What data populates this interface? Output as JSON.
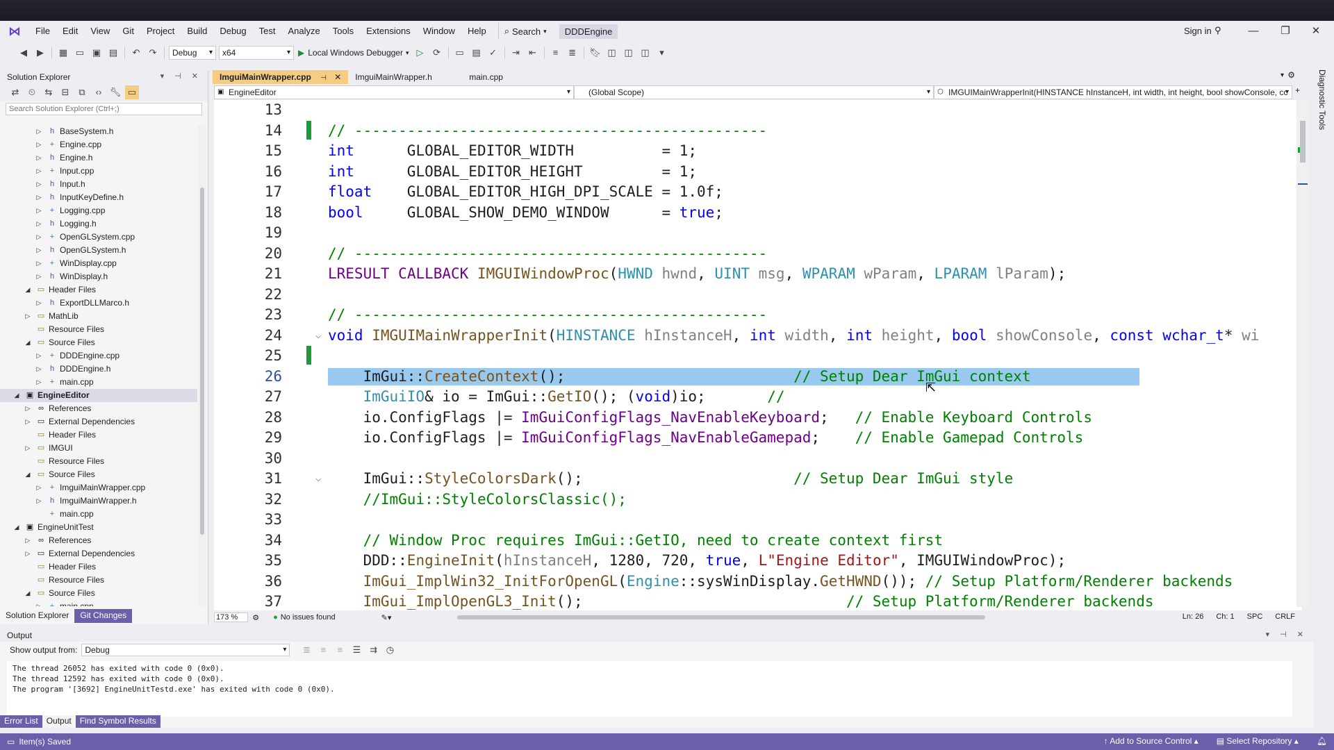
{
  "app": {
    "menu": [
      "File",
      "Edit",
      "View",
      "Git",
      "Project",
      "Build",
      "Debug",
      "Test",
      "Analyze",
      "Tools",
      "Extensions",
      "Window",
      "Help"
    ],
    "search_label": "Search",
    "solution_name": "DDDEngine",
    "sign_in": "Sign in"
  },
  "toolbar": {
    "config": "Debug",
    "platform": "x64",
    "debugger": "Local Windows Debugger"
  },
  "solution_explorer": {
    "title": "Solution Explorer",
    "search_placeholder": "Search Solution Explorer (Ctrl+;)",
    "items": [
      {
        "label": "BaseSystem.h",
        "level": 3,
        "arrow": "▷",
        "icon": "header-file"
      },
      {
        "label": "Engine.cpp",
        "level": 3,
        "arrow": "▷",
        "icon": "cpp-file"
      },
      {
        "label": "Engine.h",
        "level": 3,
        "arrow": "▷",
        "icon": "header-file"
      },
      {
        "label": "Input.cpp",
        "level": 3,
        "arrow": "▷",
        "icon": "cpp-file"
      },
      {
        "label": "Input.h",
        "level": 3,
        "arrow": "▷",
        "icon": "header-file"
      },
      {
        "label": "InputKeyDefine.h",
        "level": 3,
        "arrow": "▷",
        "icon": "header-file"
      },
      {
        "label": "Logging.cpp",
        "level": 3,
        "arrow": "▷",
        "icon": "cpp-file"
      },
      {
        "label": "Logging.h",
        "level": 3,
        "arrow": "▷",
        "icon": "header-file"
      },
      {
        "label": "OpenGLSystem.cpp",
        "level": 3,
        "arrow": "▷",
        "icon": "cpp-file"
      },
      {
        "label": "OpenGLSystem.h",
        "level": 3,
        "arrow": "▷",
        "icon": "header-file"
      },
      {
        "label": "WinDisplay.cpp",
        "level": 3,
        "arrow": "▷",
        "icon": "cpp-file"
      },
      {
        "label": "WinDisplay.h",
        "level": 3,
        "arrow": "▷",
        "icon": "header-file"
      },
      {
        "label": "Header Files",
        "level": 2,
        "arrow": "◢",
        "icon": "folder"
      },
      {
        "label": "ExportDLLMarco.h",
        "level": 3,
        "arrow": "▷",
        "icon": "header-file"
      },
      {
        "label": "MathLib",
        "level": 2,
        "arrow": "▷",
        "icon": "folder"
      },
      {
        "label": "Resource Files",
        "level": 2,
        "arrow": "",
        "icon": "folder"
      },
      {
        "label": "Source Files",
        "level": 2,
        "arrow": "◢",
        "icon": "folder"
      },
      {
        "label": "DDDEngine.cpp",
        "level": 3,
        "arrow": "▷",
        "icon": "cpp-file"
      },
      {
        "label": "DDDEngine.h",
        "level": 3,
        "arrow": "▷",
        "icon": "header-file"
      },
      {
        "label": "main.cpp",
        "level": 3,
        "arrow": "▷",
        "icon": "cpp-file"
      },
      {
        "label": "EngineEditor",
        "level": 1,
        "arrow": "◢",
        "icon": "project",
        "selected": true
      },
      {
        "label": "References",
        "level": 2,
        "arrow": "▷",
        "icon": "references"
      },
      {
        "label": "External Dependencies",
        "level": 2,
        "arrow": "▷",
        "icon": "external"
      },
      {
        "label": "Header Files",
        "level": 2,
        "arrow": "",
        "icon": "folder"
      },
      {
        "label": "IMGUI",
        "level": 2,
        "arrow": "▷",
        "icon": "folder"
      },
      {
        "label": "Resource Files",
        "level": 2,
        "arrow": "",
        "icon": "folder"
      },
      {
        "label": "Source Files",
        "level": 2,
        "arrow": "◢",
        "icon": "folder"
      },
      {
        "label": "ImguiMainWrapper.cpp",
        "level": 3,
        "arrow": "▷",
        "icon": "cpp-file"
      },
      {
        "label": "ImguiMainWrapper.h",
        "level": 3,
        "arrow": "▷",
        "icon": "header-file"
      },
      {
        "label": "main.cpp",
        "level": 3,
        "arrow": "",
        "icon": "cpp-file"
      },
      {
        "label": "EngineUnitTest",
        "level": 1,
        "arrow": "◢",
        "icon": "project"
      },
      {
        "label": "References",
        "level": 2,
        "arrow": "▷",
        "icon": "references"
      },
      {
        "label": "External Dependencies",
        "level": 2,
        "arrow": "▷",
        "icon": "external"
      },
      {
        "label": "Header Files",
        "level": 2,
        "arrow": "",
        "icon": "folder"
      },
      {
        "label": "Resource Files",
        "level": 2,
        "arrow": "",
        "icon": "folder"
      },
      {
        "label": "Source Files",
        "level": 2,
        "arrow": "◢",
        "icon": "folder"
      },
      {
        "label": "main.cpp",
        "level": 3,
        "arrow": "▷",
        "icon": "cpp-file"
      }
    ],
    "tabs": [
      "Solution Explorer",
      "Git Changes"
    ]
  },
  "editor": {
    "tabs": [
      {
        "label": "ImguiMainWrapper.cpp",
        "active": true
      },
      {
        "label": "ImguiMainWrapper.h",
        "active": false
      },
      {
        "label": "main.cpp",
        "active": false
      }
    ],
    "nav_project": "EngineEditor",
    "nav_scope": "(Global Scope)",
    "nav_member": "IMGUIMainWrapperInit(HINSTANCE hInstanceH, int width, int height, bool showConsole, cc",
    "lines": [
      {
        "n": "13",
        "tokens": []
      },
      {
        "n": "14",
        "change": true,
        "tokens": [
          [
            "cmt",
            "// -----------------------------------------------"
          ]
        ]
      },
      {
        "n": "15",
        "tokens": [
          [
            "kw",
            "int"
          ],
          [
            "",
            "      GLOBAL_EDITOR_WIDTH          = 1;"
          ]
        ]
      },
      {
        "n": "16",
        "tokens": [
          [
            "kw",
            "int"
          ],
          [
            "",
            "      GLOBAL_EDITOR_HEIGHT         = 1;"
          ]
        ]
      },
      {
        "n": "17",
        "tokens": [
          [
            "kw",
            "float"
          ],
          [
            "",
            "    GLOBAL_EDITOR_HIGH_DPI_SCALE = 1.0f;"
          ]
        ]
      },
      {
        "n": "18",
        "tokens": [
          [
            "kw",
            "bool"
          ],
          [
            "",
            "     GLOBAL_SHOW_DEMO_WINDOW      = "
          ],
          [
            "kw",
            "true"
          ],
          [
            "",
            ";"
          ]
        ]
      },
      {
        "n": "19",
        "tokens": []
      },
      {
        "n": "20",
        "tokens": [
          [
            "cmt",
            "// -----------------------------------------------"
          ]
        ]
      },
      {
        "n": "21",
        "tokens": [
          [
            "macro",
            "LRESULT"
          ],
          [
            "",
            " "
          ],
          [
            "macro",
            "CALLBACK"
          ],
          [
            "",
            " "
          ],
          [
            "fn",
            "IMGUIWindowProc"
          ],
          [
            "",
            "("
          ],
          [
            "ty",
            "HWND"
          ],
          [
            "",
            " "
          ],
          [
            "prm",
            "hwnd"
          ],
          [
            "",
            ", "
          ],
          [
            "ty",
            "UINT"
          ],
          [
            "",
            " "
          ],
          [
            "prm",
            "msg"
          ],
          [
            "",
            ", "
          ],
          [
            "ty",
            "WPARAM"
          ],
          [
            "",
            " "
          ],
          [
            "prm",
            "wParam"
          ],
          [
            "",
            ", "
          ],
          [
            "ty",
            "LPARAM"
          ],
          [
            "",
            " "
          ],
          [
            "prm",
            "lParam"
          ],
          [
            "",
            ");"
          ]
        ]
      },
      {
        "n": "22",
        "tokens": []
      },
      {
        "n": "23",
        "tokens": [
          [
            "cmt",
            "// -----------------------------------------------"
          ]
        ]
      },
      {
        "n": "24",
        "fold": "⌵",
        "tokens": [
          [
            "kw",
            "void"
          ],
          [
            "",
            " "
          ],
          [
            "fn",
            "IMGUIMainWrapperInit"
          ],
          [
            "",
            "("
          ],
          [
            "ty",
            "HINSTANCE"
          ],
          [
            "",
            " "
          ],
          [
            "prm",
            "hInstanceH"
          ],
          [
            "",
            ", "
          ],
          [
            "kw",
            "int"
          ],
          [
            "",
            " "
          ],
          [
            "prm",
            "width"
          ],
          [
            "",
            ", "
          ],
          [
            "kw",
            "int"
          ],
          [
            "",
            " "
          ],
          [
            "prm",
            "height"
          ],
          [
            "",
            ", "
          ],
          [
            "kw",
            "bool"
          ],
          [
            "",
            " "
          ],
          [
            "prm",
            "showConsole"
          ],
          [
            "",
            ", "
          ],
          [
            "kw",
            "const"
          ],
          [
            "",
            " "
          ],
          [
            "kw",
            "wchar_t"
          ],
          [
            "",
            "* "
          ],
          [
            "prm",
            "wi"
          ]
        ]
      },
      {
        "n": "25",
        "change": true,
        "tokens": []
      },
      {
        "n": "26",
        "current": true,
        "tokens": [
          [
            "",
            "    ImGui::"
          ],
          [
            "fn",
            "CreateContext"
          ],
          [
            "",
            "();                          "
          ],
          [
            "cmt",
            "// Setup Dear ImGui context"
          ]
        ]
      },
      {
        "n": "27",
        "tokens": [
          [
            "",
            "    "
          ],
          [
            "ty",
            "ImGuiIO"
          ],
          [
            "",
            "& io = ImGui::"
          ],
          [
            "fn",
            "GetIO"
          ],
          [
            "",
            "(); ("
          ],
          [
            "kw",
            "void"
          ],
          [
            "",
            ")io;       "
          ],
          [
            "cmt",
            "//"
          ]
        ]
      },
      {
        "n": "28",
        "tokens": [
          [
            "",
            "    io.ConfigFlags |= "
          ],
          [
            "macro",
            "ImGuiConfigFlags_NavEnableKeyboard"
          ],
          [
            "",
            ";   "
          ],
          [
            "cmt",
            "// Enable Keyboard Controls"
          ]
        ]
      },
      {
        "n": "29",
        "tokens": [
          [
            "",
            "    io.ConfigFlags |= "
          ],
          [
            "macro",
            "ImGuiConfigFlags_NavEnableGamepad"
          ],
          [
            "",
            ";    "
          ],
          [
            "cmt",
            "// Enable Gamepad Controls"
          ]
        ]
      },
      {
        "n": "30",
        "tokens": []
      },
      {
        "n": "31",
        "fold": "⌵",
        "tokens": [
          [
            "",
            "    ImGui::"
          ],
          [
            "fn",
            "StyleColorsDark"
          ],
          [
            "",
            "();                        "
          ],
          [
            "cmt",
            "// Setup Dear ImGui style"
          ]
        ]
      },
      {
        "n": "32",
        "tokens": [
          [
            "",
            "    "
          ],
          [
            "cmt",
            "//ImGui::StyleColorsClassic();"
          ]
        ]
      },
      {
        "n": "33",
        "tokens": []
      },
      {
        "n": "34",
        "tokens": [
          [
            "",
            "    "
          ],
          [
            "cmt",
            "// Window Proc requires ImGui::GetIO, need to create context first"
          ]
        ]
      },
      {
        "n": "35",
        "tokens": [
          [
            "",
            "    DDD::"
          ],
          [
            "fn",
            "EngineInit"
          ],
          [
            "",
            "("
          ],
          [
            "prm",
            "hInstanceH"
          ],
          [
            "",
            ", 1280, 720, "
          ],
          [
            "kw",
            "true"
          ],
          [
            "",
            ", "
          ],
          [
            "str",
            "L\"Engine Editor\""
          ],
          [
            "",
            ", IMGUIWindowProc);"
          ]
        ]
      },
      {
        "n": "36",
        "tokens": [
          [
            "",
            "    "
          ],
          [
            "fn",
            "ImGui_ImplWin32_InitForOpenGL"
          ],
          [
            "",
            "("
          ],
          [
            "ty",
            "Engine"
          ],
          [
            "",
            "::sysWinDisplay."
          ],
          [
            "fn",
            "GetHWND"
          ],
          [
            "",
            "()); "
          ],
          [
            "cmt",
            "// Setup Platform/Renderer backends"
          ]
        ]
      },
      {
        "n": "37",
        "tokens": [
          [
            "",
            "    "
          ],
          [
            "fn",
            "ImGui_ImplOpenGL3_Init"
          ],
          [
            "",
            "();                              "
          ],
          [
            "cmt",
            "// Setup Platform/Renderer backends"
          ]
        ]
      }
    ],
    "zoom": "173 %",
    "issues": "No issues found",
    "ln": "Ln: 26",
    "ch": "Ch: 1",
    "spc": "SPC",
    "eol": "CRLF"
  },
  "diagnostic_tools": "Diagnostic Tools",
  "output": {
    "title": "Output",
    "show_from_label": "Show output from:",
    "source": "Debug",
    "lines": [
      "The thread 26052 has exited with code 0 (0x0).",
      "The thread 12592 has exited with code 0 (0x0).",
      "The program '[3692] EngineUnitTestd.exe' has exited with code 0 (0x0)."
    ],
    "tabs": [
      "Error List",
      "Output",
      "Find Symbol Results"
    ]
  },
  "statusbar": {
    "message": "Item(s) Saved",
    "source_control": "Add to Source Control",
    "repository": "Select Repository"
  },
  "colors": {
    "accent": "#6a5fa8",
    "active_tab": "#f5cc84",
    "selection": "#99c9ef",
    "change_bar": "#1d9b3a"
  }
}
